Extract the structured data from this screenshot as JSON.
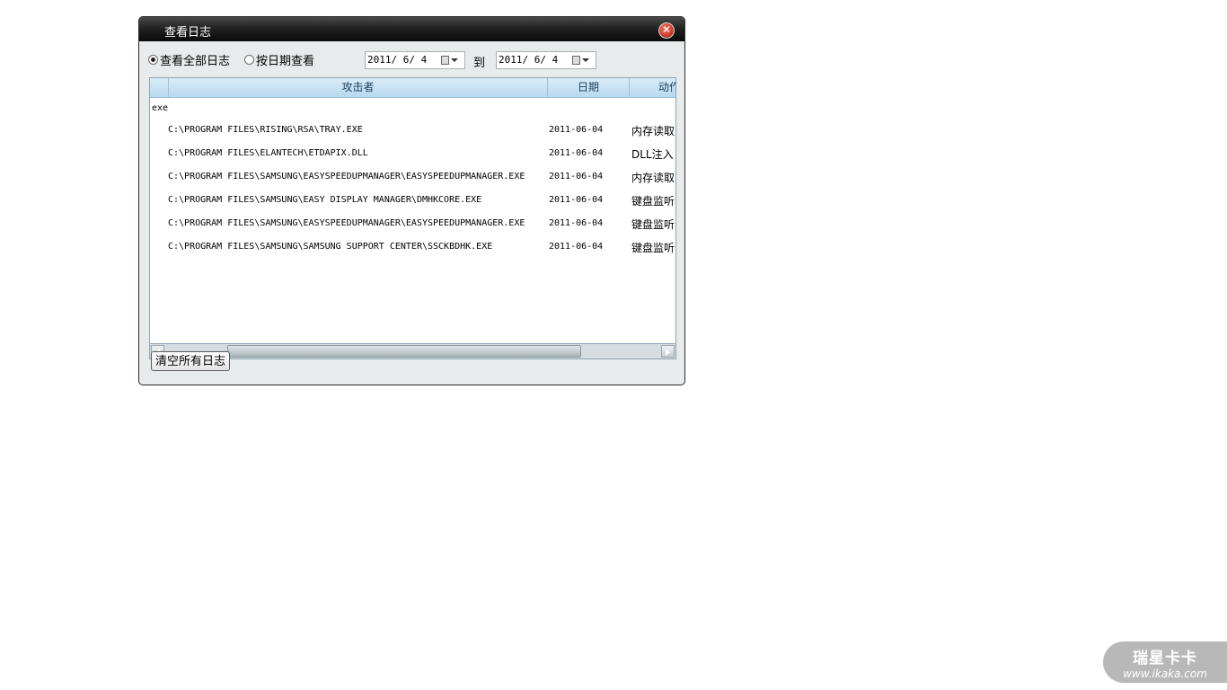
{
  "dialog": {
    "title": "查看日志",
    "close_symbol": "✕"
  },
  "filter": {
    "radio_all_label": "查看全部日志",
    "radio_all_selected": true,
    "radio_date_label": "按日期查看",
    "radio_date_selected": false,
    "date_from": "2011/ 6/ 4",
    "to_label": "到",
    "date_to": "2011/ 6/ 4"
  },
  "table": {
    "columns": [
      "攻击者",
      "日期",
      "动作"
    ],
    "group_label": "exe",
    "rows": [
      {
        "path": "C:\\PROGRAM FILES\\RISING\\RSA\\TRAY.EXE",
        "date": "2011-06-04",
        "action": "内存读取"
      },
      {
        "path": "C:\\PROGRAM FILES\\ELANTECH\\ETDAPIX.DLL",
        "date": "2011-06-04",
        "action": "DLL注入"
      },
      {
        "path": "C:\\PROGRAM FILES\\SAMSUNG\\EASYSPEEDUPMANAGER\\EASYSPEEDUPMANAGER.EXE",
        "date": "2011-06-04",
        "action": "内存读取"
      },
      {
        "path": "C:\\PROGRAM FILES\\SAMSUNG\\EASY DISPLAY MANAGER\\DMHKCORE.EXE",
        "date": "2011-06-04",
        "action": "键盘监听"
      },
      {
        "path": "C:\\PROGRAM FILES\\SAMSUNG\\EASYSPEEDUPMANAGER\\EASYSPEEDUPMANAGER.EXE",
        "date": "2011-06-04",
        "action": "键盘监听"
      },
      {
        "path": "C:\\PROGRAM FILES\\SAMSUNG\\SAMSUNG SUPPORT CENTER\\SSCKBDHK.EXE",
        "date": "2011-06-04",
        "action": "键盘监听"
      }
    ]
  },
  "actions": {
    "clear_button": "清空所有日志"
  },
  "watermark": {
    "brand": "瑞星卡卡",
    "url": "www.ikaka.com"
  }
}
